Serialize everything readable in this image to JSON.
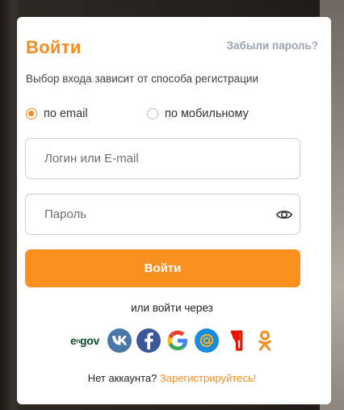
{
  "login_card": {
    "title": "Войти",
    "forgot_password": "Забыли пароль?",
    "subtitle": "Выбор входа зависит от способа регистрации",
    "method_options": [
      {
        "label": "по email",
        "selected": true
      },
      {
        "label": "по мобильному",
        "selected": false
      }
    ],
    "login_field": {
      "value": "",
      "placeholder": "Логин или E-mail"
    },
    "password_field": {
      "value": "",
      "placeholder": "Пароль"
    },
    "submit_label": "Войти",
    "alt_login_text": "или войти через",
    "social_providers": [
      {
        "name": "egov",
        "label": "egov",
        "icon": "egov-icon"
      },
      {
        "name": "vk",
        "icon": "vk-icon"
      },
      {
        "name": "facebook",
        "icon": "facebook-icon"
      },
      {
        "name": "google",
        "icon": "google-icon"
      },
      {
        "name": "mail",
        "icon": "mail-at-icon"
      },
      {
        "name": "yandex",
        "icon": "yandex-icon"
      },
      {
        "name": "odnoklassniki",
        "icon": "odnoklassniki-icon"
      }
    ],
    "register_prompt": "Нет аккаунта?",
    "register_link": "Зарегистрируйтесь!"
  },
  "colors": {
    "accent": "#f58b1f",
    "muted": "#9aa3b3",
    "vk": "#4a76a8",
    "facebook": "#3b5998",
    "mail": "#168de2",
    "yandex": "#e61400"
  }
}
